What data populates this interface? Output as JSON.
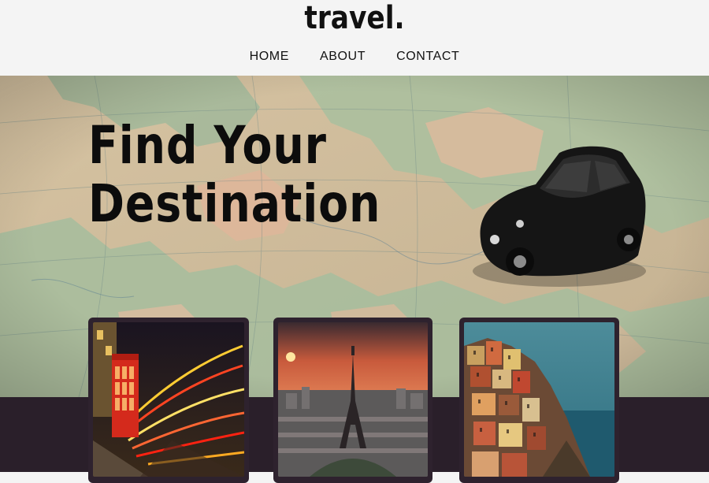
{
  "header": {
    "brand": "travel.",
    "nav": [
      {
        "label": "HOME"
      },
      {
        "label": "ABOUT"
      },
      {
        "label": "CONTACT"
      }
    ]
  },
  "hero": {
    "title_line1": "Find Your",
    "title_line2": "Destination"
  },
  "cards": [
    {
      "subject": "london-phone-booth-night"
    },
    {
      "subject": "paris-eiffel-tower-sunset"
    },
    {
      "subject": "coastal-cliff-village"
    }
  ],
  "colors": {
    "header_bg": "#f4f4f4",
    "band_bg": "#2a1f2a",
    "card_frame": "#2e222e",
    "text_dark": "#0c0c0c"
  }
}
